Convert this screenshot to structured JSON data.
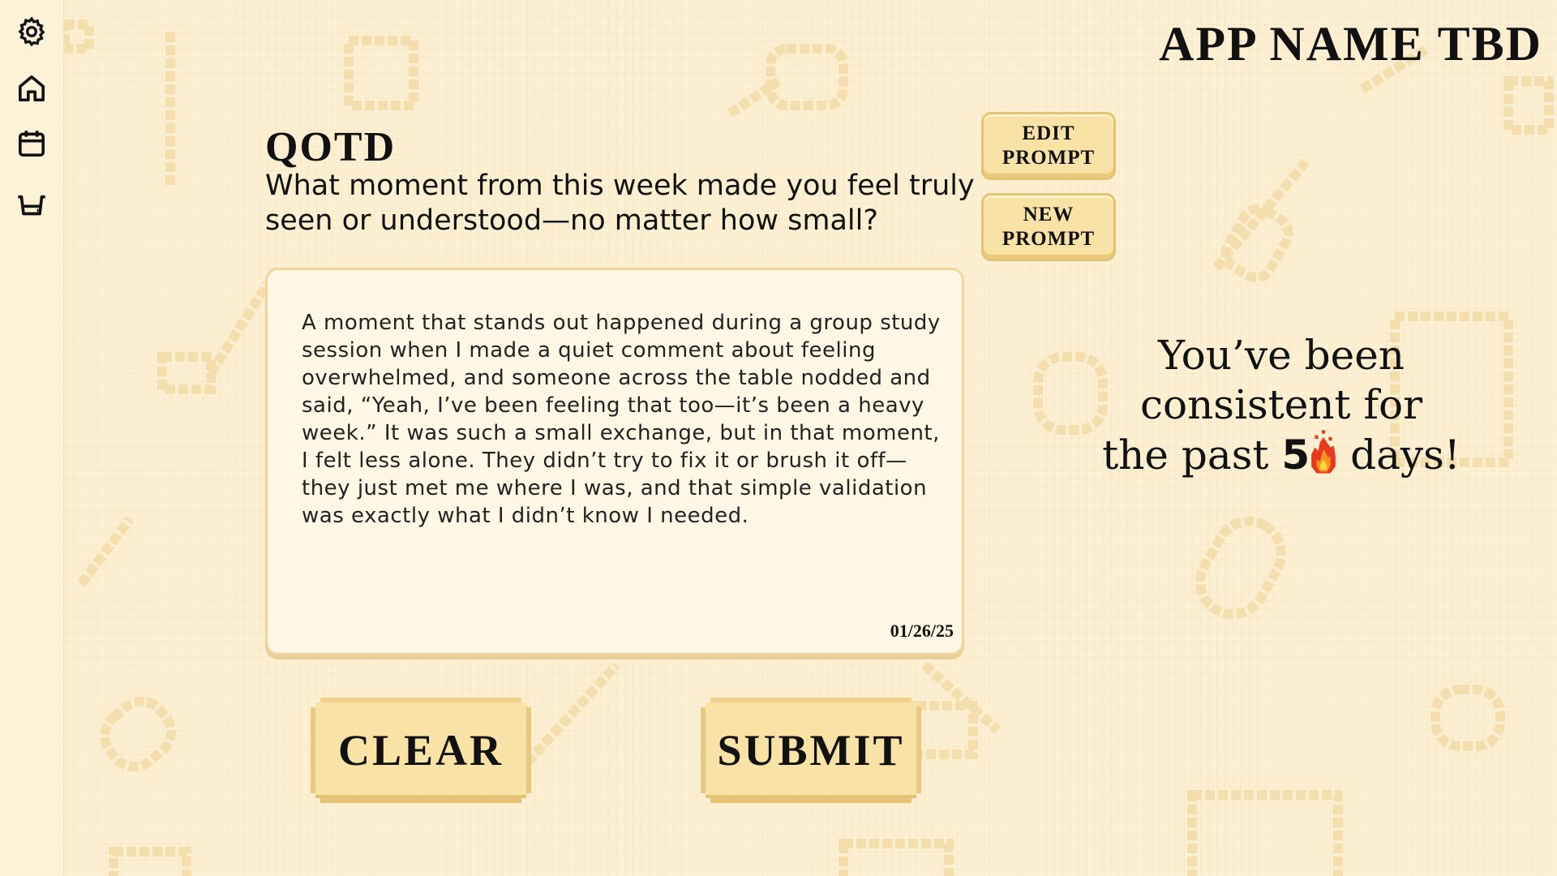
{
  "app": {
    "title": "APP NAME TBD"
  },
  "sidebar": {
    "items": [
      {
        "name": "settings",
        "icon": "gear-icon"
      },
      {
        "name": "home",
        "icon": "home-icon"
      },
      {
        "name": "calendar",
        "icon": "calendar-icon"
      },
      {
        "name": "shop",
        "icon": "basket-icon"
      }
    ]
  },
  "qotd": {
    "label": "QOTD",
    "question": "What moment from this week made you feel truly seen or understood—no matter how small?"
  },
  "prompt_buttons": {
    "edit_line1": "EDIT",
    "edit_line2": "PROMPT",
    "new_line1": "NEW",
    "new_line2": "PROMPT"
  },
  "entry": {
    "text": "A moment that stands out happened during a group study session when I made a quiet comment about feeling overwhelmed, and someone across the table nodded and said, “Yeah, I’ve been feeling that too—it’s been a heavy week.” It was such a small exchange, but in that moment, I felt less alone. They didn’t try to fix it or brush it off—they just met me where I was, and that simple validation was exactly what I didn’t know I needed.",
    "date": "01/26/25"
  },
  "actions": {
    "clear_label": "CLEAR",
    "submit_label": "SUBMIT"
  },
  "streak": {
    "line1": "You’ve been",
    "line2": "consistent for",
    "prefix": "the past",
    "count": "5",
    "suffix": "days!",
    "icon": "fire-icon"
  },
  "colors": {
    "background": "#fdf0d2",
    "button_fill": "#f9e2a6",
    "button_border": "#e5c274",
    "card_fill": "#fff7e6"
  }
}
